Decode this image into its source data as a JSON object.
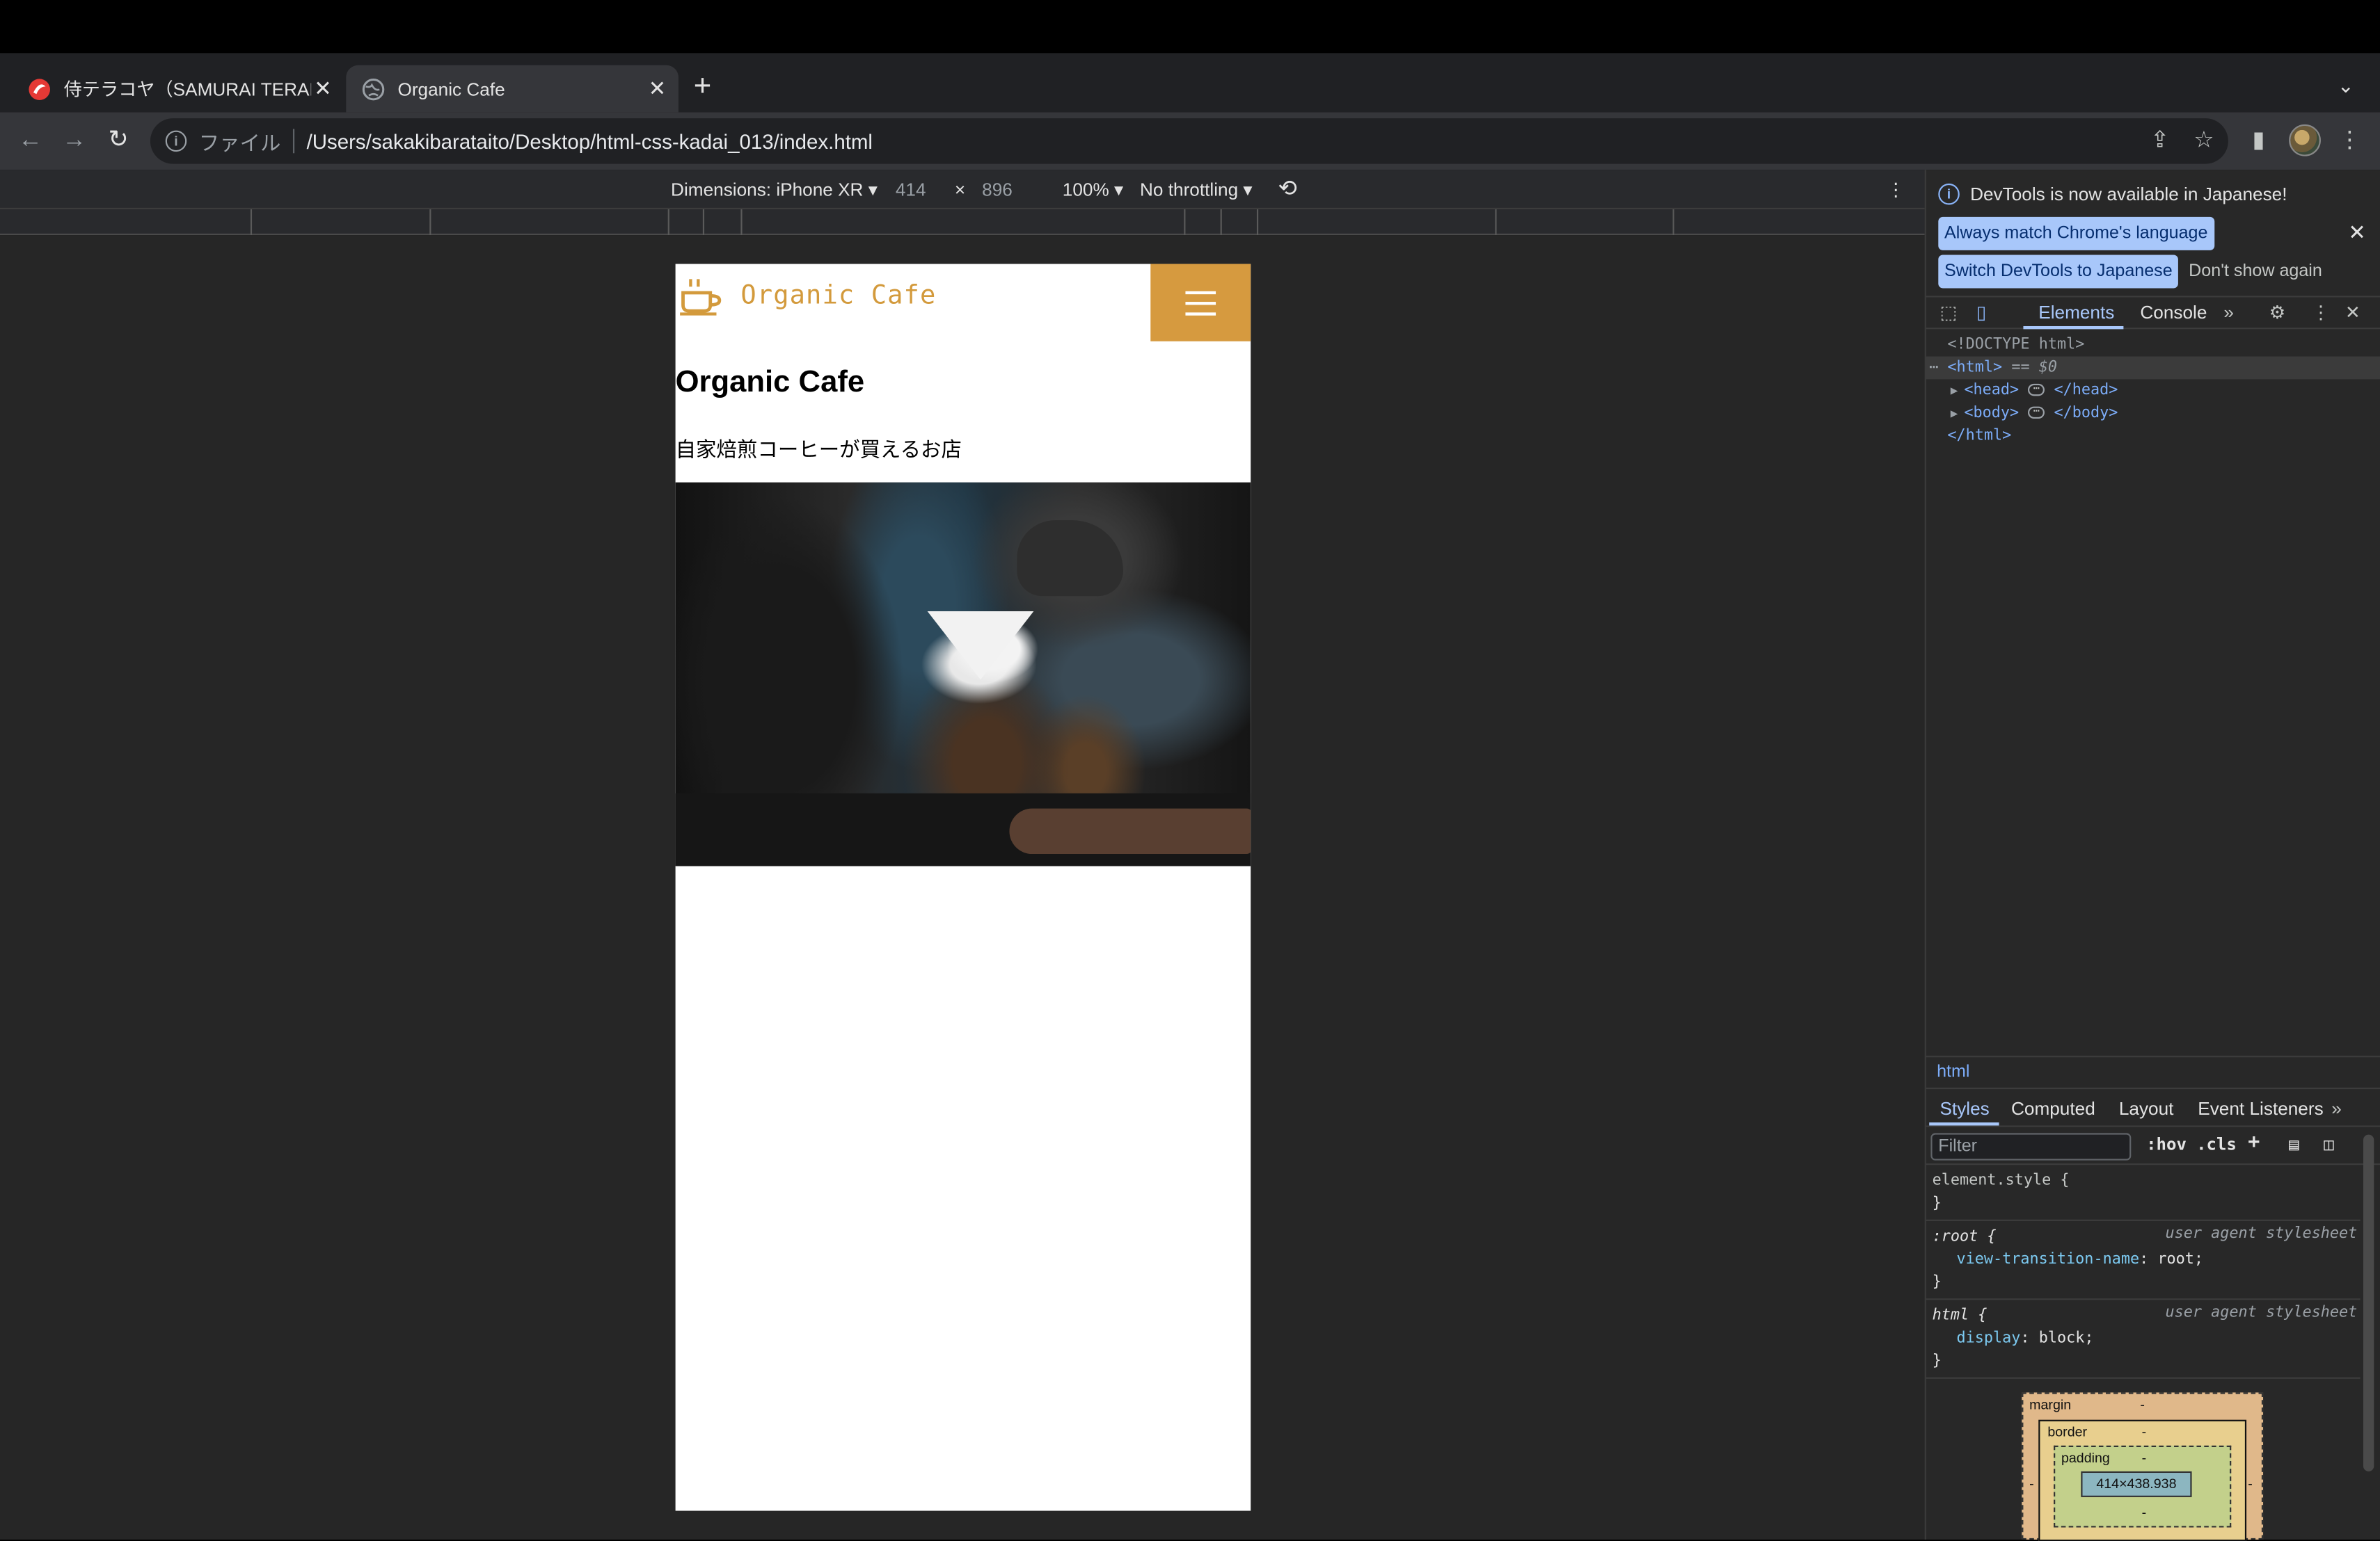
{
  "browser": {
    "tabs": [
      {
        "title": "侍テラコヤ（SAMURAI TERAKO",
        "active": false
      },
      {
        "title": "Organic Cafe",
        "active": true
      }
    ],
    "new_tab": "+",
    "close": "✕",
    "address": {
      "scheme_label": "ファイル",
      "url": "/Users/sakakibarataito/Desktop/html-css-kadai_013/index.html"
    }
  },
  "device_toolbar": {
    "dimensions_label": "Dimensions: iPhone XR",
    "width": "414",
    "times": "×",
    "height": "896",
    "zoom": "100%",
    "throttling": "No throttling"
  },
  "site": {
    "logo_text": "Organic Cafe",
    "title": "Organic Cafe",
    "subtitle": "自家焙煎コーヒーが買えるお店",
    "brand_color": "#d69a3f"
  },
  "devtools": {
    "banner_text": "DevTools is now available in Japanese!",
    "btn_match": "Always match Chrome's language",
    "btn_switch": "Switch DevTools to Japanese",
    "btn_dont": "Don't show again",
    "tabs": {
      "elements": "Elements",
      "console": "Console"
    },
    "dom": {
      "doctype": "<!DOCTYPE html>",
      "html_open": "<html>",
      "dollar0": "== $0",
      "head_open": "<head>",
      "head_close": "</head>",
      "body_open": "<body>",
      "body_close": "</body>",
      "html_close": "</html>"
    },
    "breadcrumb": "html",
    "style_tabs": {
      "styles": "Styles",
      "computed": "Computed",
      "layout": "Layout",
      "listeners": "Event Listeners"
    },
    "filter_placeholder": "Filter",
    "hov": ":hov",
    "cls": ".cls",
    "rules": {
      "element_style": "element.style {",
      "close": "}",
      "root_sel": ":root {",
      "ua": "user agent stylesheet",
      "root_prop": "view-transition-name",
      "root_val": "root;",
      "html_sel": "html {",
      "html_prop": "display",
      "html_val": "block;"
    },
    "box_model": {
      "margin": "margin",
      "border": "border",
      "padding": "padding",
      "dash": "-",
      "content": "414×438.938"
    }
  }
}
